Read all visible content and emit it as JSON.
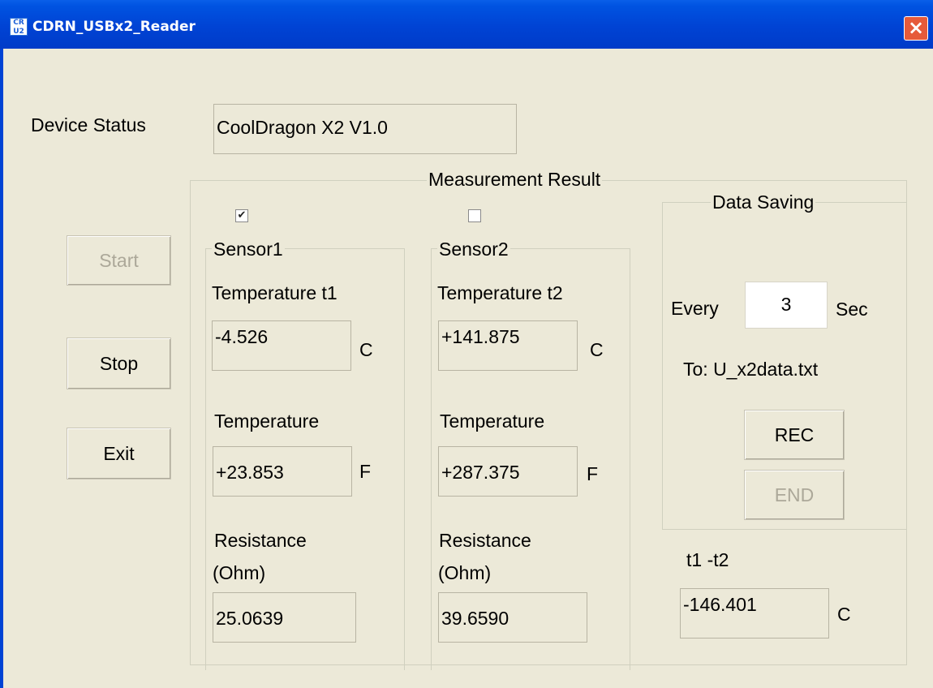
{
  "window": {
    "title": "CDRN_USBx2_Reader",
    "icon": "app-icon",
    "close": "×"
  },
  "device_status": {
    "label": "Device Status",
    "value": "CoolDragon X2 V1.0"
  },
  "buttons": {
    "start": "Start",
    "stop": "Stop",
    "exit": "Exit"
  },
  "measurement": {
    "title": "Measurement Result",
    "sensor1": {
      "enabled": true,
      "check_mark": "✔",
      "title": "Sensor1",
      "temp_c_label": "Temperature t1",
      "temp_c_value": "-4.526",
      "temp_c_unit": "C",
      "temp_f_label": "Temperature",
      "temp_f_value": "+23.853",
      "temp_f_unit": "F",
      "resistance_label_1": "Resistance",
      "resistance_label_2": "(Ohm)",
      "resistance_value": "25.0639"
    },
    "sensor2": {
      "enabled": false,
      "check_mark": "",
      "title": "Sensor2",
      "temp_c_label": "Temperature t2",
      "temp_c_value": "+141.875",
      "temp_c_unit": "C",
      "temp_f_label": "Temperature",
      "temp_f_value": "+287.375",
      "temp_f_unit": "F",
      "resistance_label_1": "Resistance",
      "resistance_label_2": "(Ohm)",
      "resistance_value": "39.6590"
    },
    "data_saving": {
      "title": "Data Saving",
      "every_label": "Every",
      "interval": "3",
      "unit": "Sec",
      "target": "To: U_x2data.txt",
      "rec": "REC",
      "end": "END"
    },
    "diff": {
      "label": "t1 -t2",
      "value": "-146.401",
      "unit": "C"
    }
  }
}
